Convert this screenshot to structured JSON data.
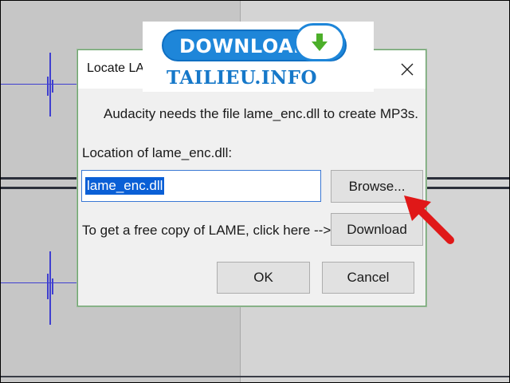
{
  "dialog": {
    "title": "Locate LAME",
    "message": "Audacity needs the file lame_enc.dll to create MP3s.",
    "location_label": "Location of lame_enc.dll:",
    "path_value": "lame_enc.dll",
    "browse_label": "Browse...",
    "free_copy_text": "To get a free copy of LAME, click here -->",
    "download_label": "Download",
    "ok_label": "OK",
    "cancel_label": "Cancel"
  },
  "watermark": {
    "badge_text": "DOWNLOAD",
    "brand_text": "TAILIEU.INFO"
  },
  "icons": [
    "close-icon",
    "download-arrow-icon",
    "pointer-arrow-icon"
  ],
  "colors": {
    "waveform": "#3f3fd0",
    "selection": "#0a5fd6",
    "annotation_arrow": "#e01818",
    "logo_blue": "#1e86d9",
    "logo_green": "#4caf2a"
  }
}
